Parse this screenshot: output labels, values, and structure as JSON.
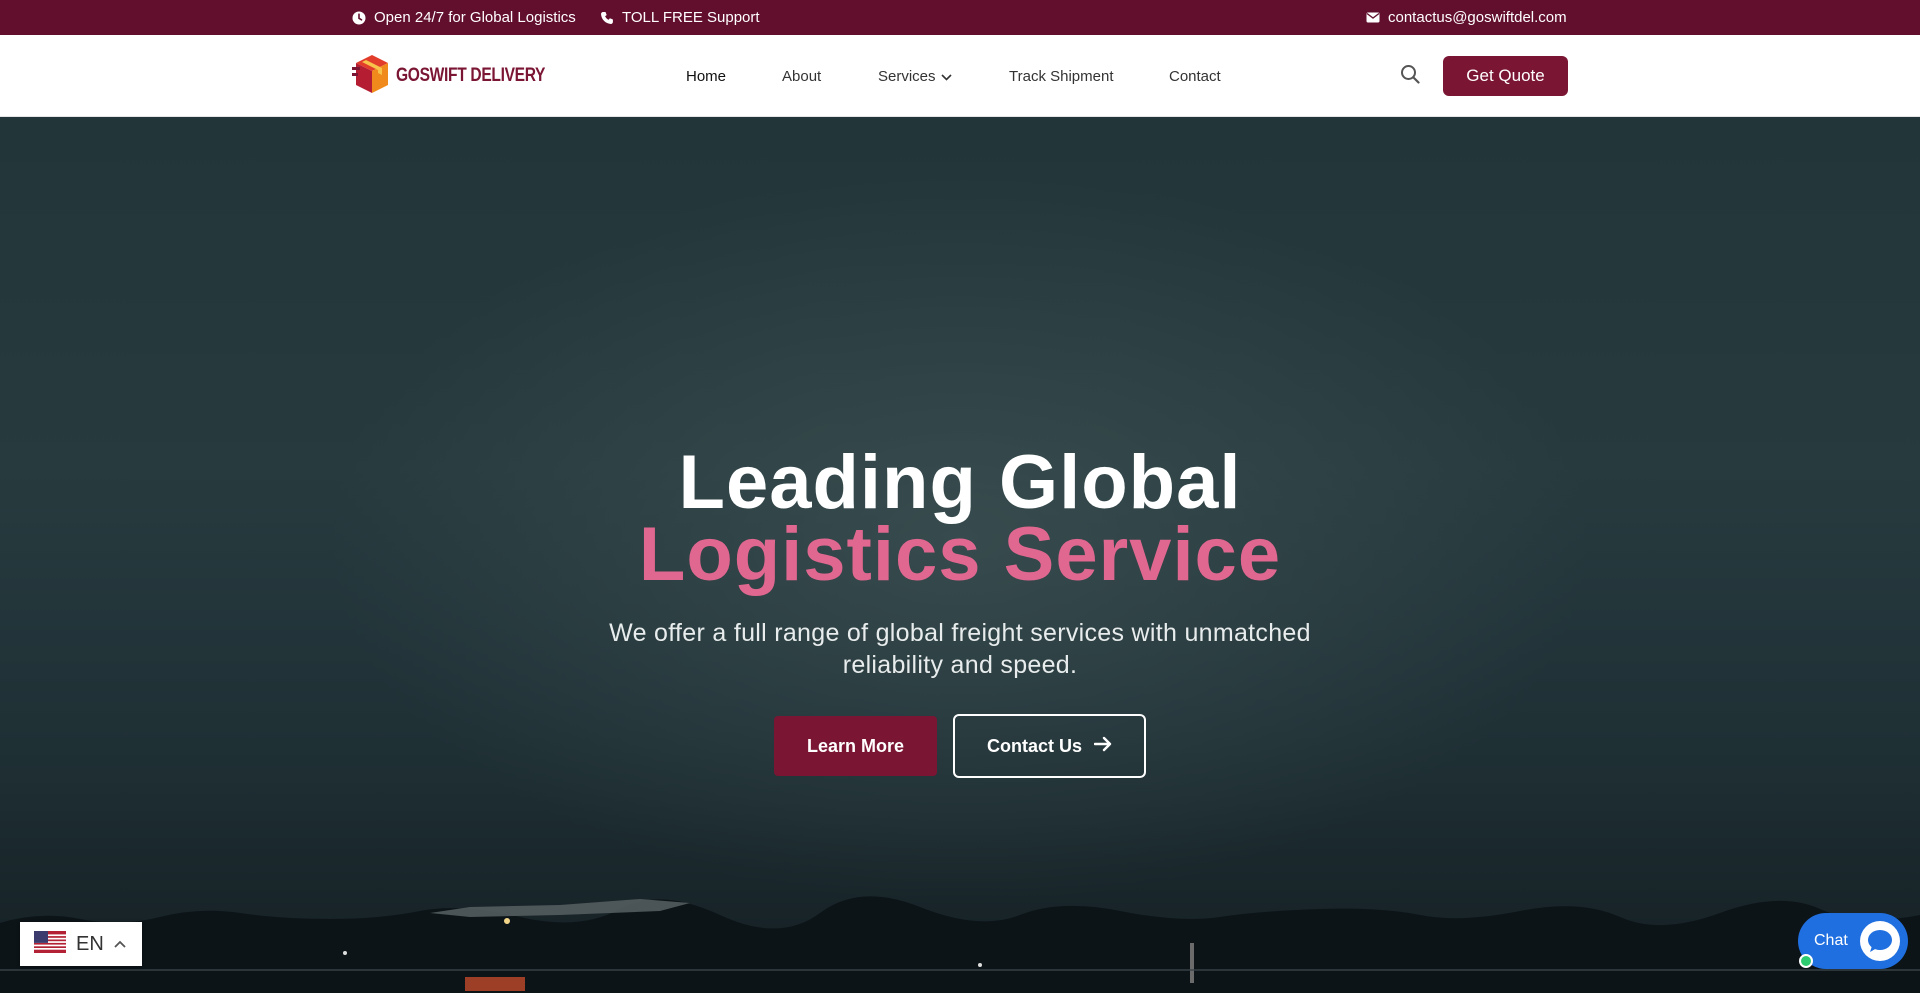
{
  "topbar": {
    "hours": "Open 24/7 for Global Logistics",
    "support": "TOLL FREE Support",
    "email": "contactus@goswiftdel.com",
    "icons": [
      "clock-icon",
      "phone-icon",
      "mail-icon"
    ]
  },
  "header": {
    "logo_text": "GOSWIFT DELIVERY",
    "nav": {
      "home": "Home",
      "about": "About",
      "services": "Services",
      "track": "Track Shipment",
      "contact": "Contact"
    },
    "quote_label": "Get Quote"
  },
  "hero": {
    "title_line1": "Leading Global",
    "title_line2": "Logistics Service",
    "subtitle": "We offer a full range of global freight services with unmatched reliability and speed.",
    "learn_more": "Learn More",
    "contact_us": "Contact Us"
  },
  "language": {
    "code": "EN"
  },
  "chat": {
    "label": "Chat"
  },
  "colors": {
    "brand": "#7a1533",
    "topbar": "#620f2d",
    "accent_pink": "#e0678f",
    "chat_blue": "#1f6fe0"
  }
}
